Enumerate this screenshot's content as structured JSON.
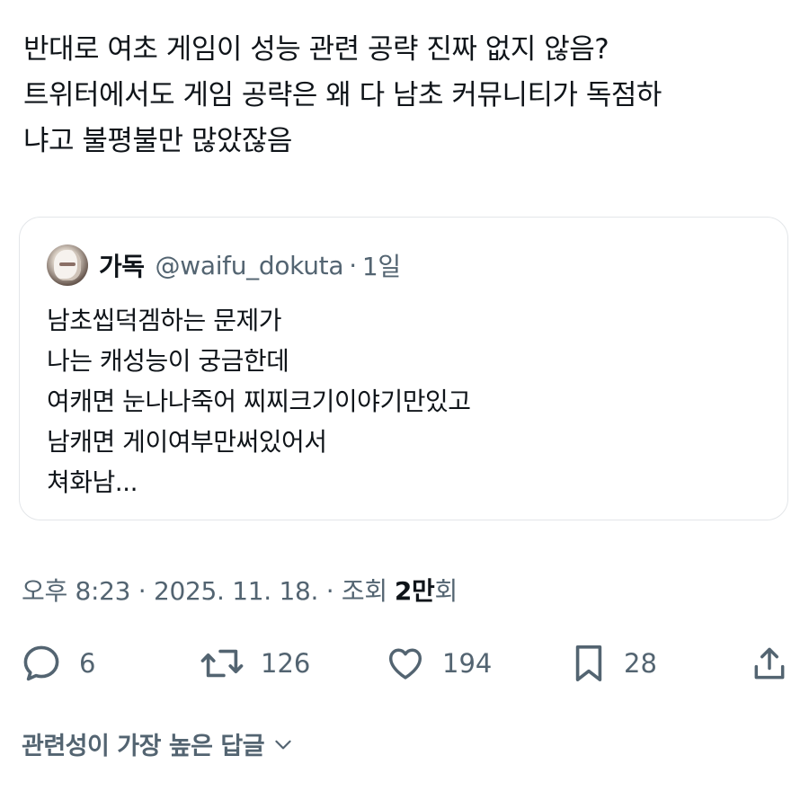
{
  "tweet": {
    "text_lines": [
      "반대로 여초 게임이 성능 관련 공략 진짜 없지 않음?",
      "트위터에서도 게임 공략은 왜 다 남초 커뮤니티가 독점하",
      "냐고 불평불만 많았잖음"
    ]
  },
  "quote": {
    "avatar_icon": "anime-avatar",
    "name": "가독",
    "handle": "@waifu_dokuta",
    "separator": "·",
    "time": "1일",
    "body_lines": [
      "남초씹덕겜하는 문제가",
      "나는 캐성능이 궁금한데",
      "여캐면 눈나나죽어 찌찌크기이야기만있고",
      "남캐면 게이여부만써있어서",
      "쳐화남..."
    ]
  },
  "meta": {
    "timestamp": "오후 8:23 · 2025. 11. 18. · 조회",
    "views": "2만",
    "views_suffix": "회"
  },
  "actions": {
    "reply_count": "6",
    "retweet_count": "126",
    "like_count": "194",
    "bookmark_count": "28"
  },
  "replies_sort": {
    "label": "관련성이 가장 높은 답글"
  },
  "colors": {
    "text": "#0f1419",
    "secondary": "#536471",
    "border": "#e3e6e9"
  }
}
